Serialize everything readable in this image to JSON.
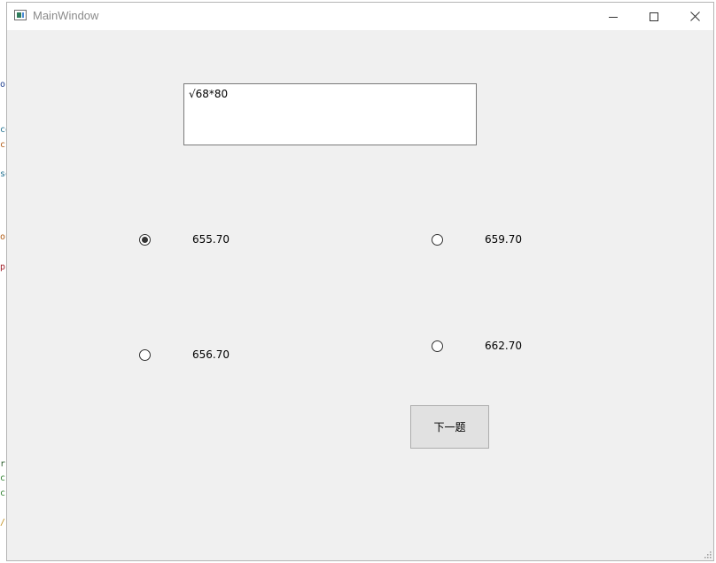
{
  "background": {
    "fragments": [
      {
        "text": "or",
        "color": "#1f3f8f"
      },
      {
        "text": "ce",
        "color": "#1f6f8f"
      },
      {
        "text": "c",
        "color": "#b05a14"
      },
      {
        "text": "se",
        "color": "#1f6f8f"
      },
      {
        "text": "ou",
        "color": "#b05a14"
      },
      {
        "text": "p",
        "color": "#a0202a"
      },
      {
        "text": "r",
        "color": "#2f5f2f"
      },
      {
        "text": "c",
        "color": "#2f7f2f"
      },
      {
        "text": "c",
        "color": "#2f7f2f"
      },
      {
        "text": "/",
        "color": "#c09020"
      }
    ]
  },
  "window": {
    "title": "MainWindow",
    "icon": "qt-app-icon",
    "controls": {
      "minimize": "minimize-icon",
      "maximize": "maximize-icon",
      "close": "close-icon"
    }
  },
  "question": {
    "text": "√68*80"
  },
  "options": [
    {
      "label": "655.70",
      "checked": true
    },
    {
      "label": "659.70",
      "checked": false
    },
    {
      "label": "656.70",
      "checked": false
    },
    {
      "label": "662.70",
      "checked": false
    }
  ],
  "next_button": {
    "label": "下一题"
  },
  "colors": {
    "window_bg": "#f0f0f0",
    "titlebar_bg": "#ffffff",
    "button_bg": "#e1e1e1"
  }
}
